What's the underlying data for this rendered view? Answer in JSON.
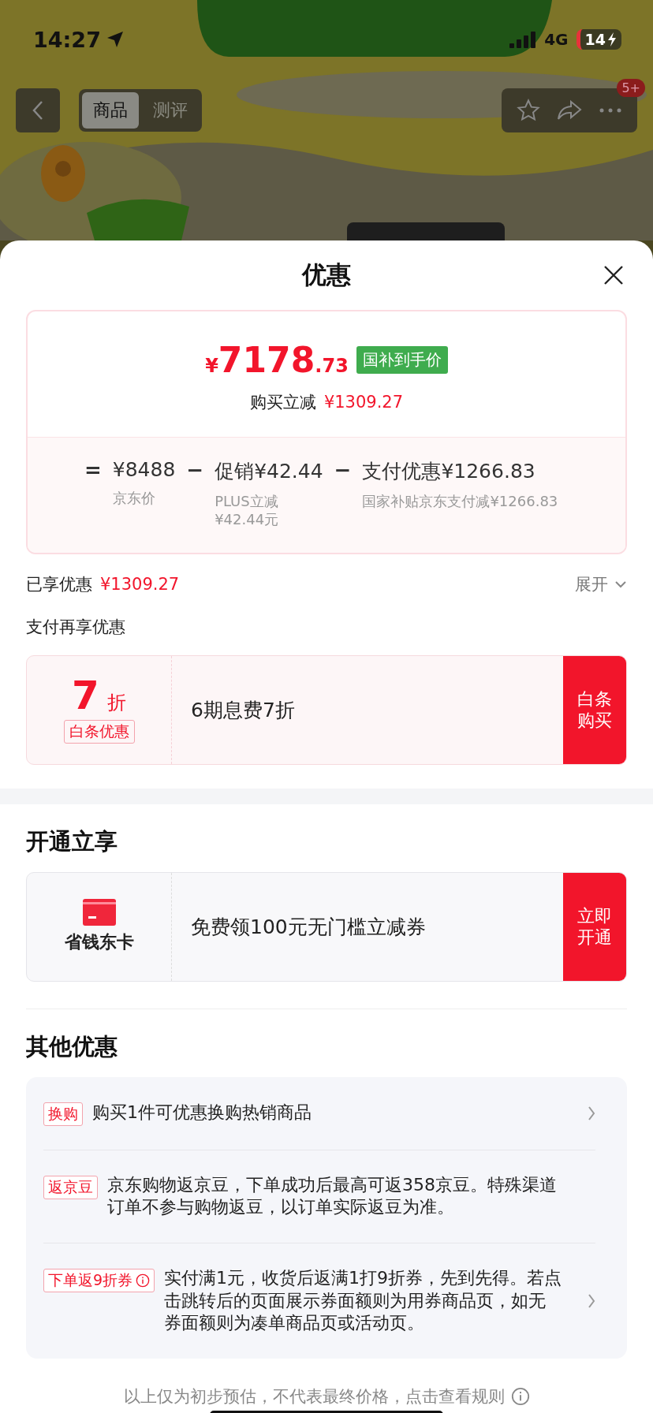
{
  "status_bar": {
    "time": "14:27",
    "network": "4G",
    "battery": "14"
  },
  "nav": {
    "tabs": [
      {
        "label": "商品",
        "selected": true
      },
      {
        "label": "测评",
        "selected": false
      }
    ],
    "badge": "5+"
  },
  "sheet": {
    "title": "优惠"
  },
  "price": {
    "currency": "¥",
    "integer": "7178",
    "decimal": ".73",
    "tag": "国补到手价",
    "reduction_label": "购买立减",
    "reduction": "¥1309.27"
  },
  "breakdown": [
    {
      "op": "=",
      "amount": "¥8488",
      "note_lines": [
        "京东价"
      ]
    },
    {
      "op": "−",
      "amount": "促销¥42.44",
      "note_lines": [
        "PLUS立减",
        "¥42.44元"
      ]
    },
    {
      "op": "−",
      "amount": "支付优惠¥1266.83",
      "note_lines": [
        "国家补贴京东支付减¥1266.83"
      ]
    }
  ],
  "applied": {
    "label": "已享优惠",
    "amount": "¥1309.27",
    "expand": "展开"
  },
  "pay_section": {
    "title": "支付再享优惠",
    "offer": {
      "value": "7",
      "unit": "折",
      "tag": "白条优惠",
      "text": "6期息费7折",
      "button": "白条购买"
    }
  },
  "open_section": {
    "title": "开通立享",
    "offer": {
      "name": "省钱东卡",
      "text": "免费领100元无门槛立减券",
      "button": "立即开通"
    }
  },
  "other": {
    "title": "其他优惠",
    "items": [
      {
        "tag": "换购",
        "info": false,
        "arrow": true,
        "text": "购买1件可优惠换购热销商品"
      },
      {
        "tag": "返京豆",
        "info": false,
        "arrow": false,
        "text": "京东购物返京豆，下单成功后最高可返358京豆。特殊渠道订单不参与购物返豆，以订单实际返豆为准。"
      },
      {
        "tag": "下单返9折券",
        "info": true,
        "arrow": true,
        "text": "实付满1元，收货后返满1打9折券，先到先得。若点击跳转后的页面展示券面额则为用券商品页，如无券面额则为凑单商品页或活动页。"
      }
    ]
  },
  "footer": {
    "text": "以上仅为初步预估，不代表最终价格，点击查看规则"
  }
}
